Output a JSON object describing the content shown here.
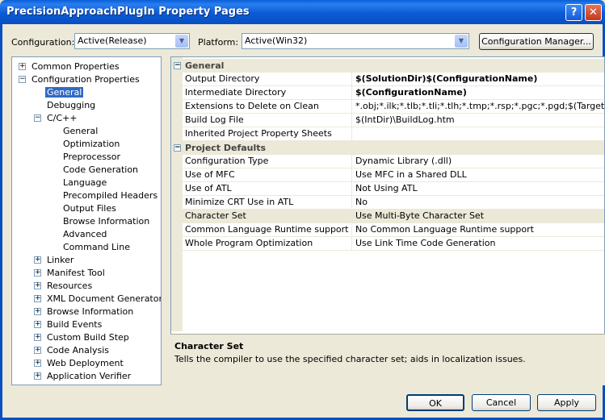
{
  "window": {
    "title": "PrecisionApproachPlugIn Property Pages",
    "help_glyph": "?",
    "close_glyph": "✕"
  },
  "config_row": {
    "configuration_label": "Configuration:",
    "configuration_value": "Active(Release)",
    "platform_label": "Platform:",
    "platform_value": "Active(Win32)",
    "manager_button": "Configuration Manager..."
  },
  "tree": {
    "common_properties": "Common Properties",
    "configuration_properties": "Configuration Properties",
    "general": "General",
    "debugging": "Debugging",
    "cpp": "C/C++",
    "cpp_children": [
      "General",
      "Optimization",
      "Preprocessor",
      "Code Generation",
      "Language",
      "Precompiled Headers",
      "Output Files",
      "Browse Information",
      "Advanced",
      "Command Line"
    ],
    "collapsed_groups": [
      "Linker",
      "Manifest Tool",
      "Resources",
      "XML Document Generator",
      "Browse Information",
      "Build Events",
      "Custom Build Step",
      "Code Analysis",
      "Web Deployment",
      "Application Verifier"
    ]
  },
  "grid": {
    "general_category": "General",
    "general_rows": [
      {
        "name": "Output Directory",
        "value": "$(SolutionDir)$(ConfigurationName)",
        "bold": true
      },
      {
        "name": "Intermediate Directory",
        "value": "$(ConfigurationName)",
        "bold": true
      },
      {
        "name": "Extensions to Delete on Clean",
        "value": "*.obj;*.ilk;*.tlb;*.tli;*.tlh;*.tmp;*.rsp;*.pgc;*.pgd;$(TargetP",
        "bold": false
      },
      {
        "name": "Build Log File",
        "value": "$(IntDir)\\BuildLog.htm",
        "bold": false
      },
      {
        "name": "Inherited Project Property Sheets",
        "value": "",
        "bold": false
      }
    ],
    "defaults_category": "Project Defaults",
    "defaults_rows": [
      {
        "name": "Configuration Type",
        "value": "Dynamic Library (.dll)"
      },
      {
        "name": "Use of MFC",
        "value": "Use MFC in a Shared DLL"
      },
      {
        "name": "Use of ATL",
        "value": "Not Using ATL"
      },
      {
        "name": "Minimize CRT Use in ATL",
        "value": "No"
      },
      {
        "name": "Character Set",
        "value": "Use Multi-Byte Character Set"
      },
      {
        "name": "Common Language Runtime support",
        "value": "No Common Language Runtime support"
      },
      {
        "name": "Whole Program Optimization",
        "value": "Use Link Time Code Generation"
      }
    ]
  },
  "description": {
    "title": "Character Set",
    "text": "Tells the compiler to use the specified character set; aids in localization issues."
  },
  "buttons": {
    "ok": "OK",
    "cancel": "Cancel",
    "apply": "Apply"
  }
}
